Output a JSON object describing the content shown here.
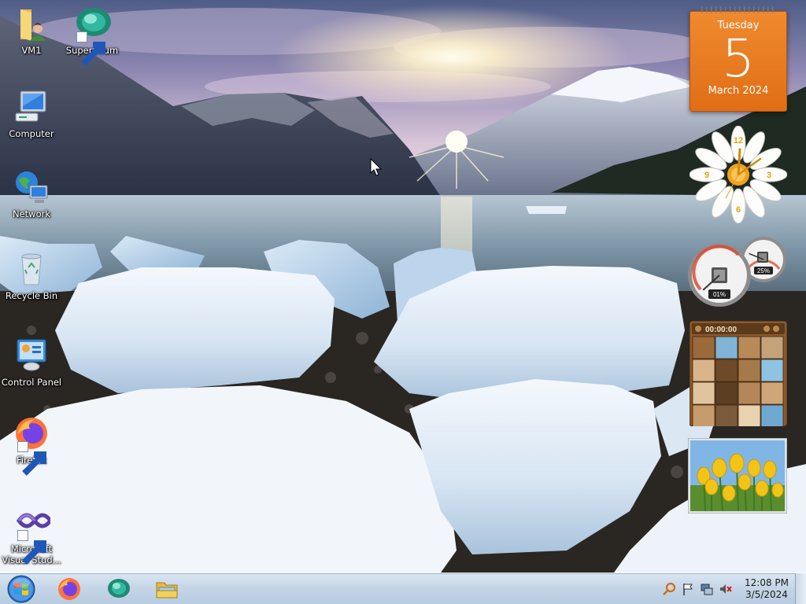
{
  "desktop": {
    "icons": [
      {
        "label": "VM1",
        "icon": "user-folder-icon"
      },
      {
        "label": "Supermium",
        "icon": "supermium-icon"
      },
      {
        "label": "Computer",
        "icon": "computer-icon"
      },
      {
        "label": "Network",
        "icon": "network-icon"
      },
      {
        "label": "Recycle Bin",
        "icon": "recycle-bin-icon"
      },
      {
        "label": "Control Panel",
        "icon": "control-panel-icon"
      },
      {
        "label": "Firefox",
        "icon": "firefox-icon"
      },
      {
        "label": "Microsoft\nVisual Stud...",
        "icon": "visual-studio-icon"
      }
    ]
  },
  "gadgets": {
    "calendar": {
      "day": "Tuesday",
      "date": "5",
      "month": "March 2024"
    },
    "cpu_meter": {
      "cpu": "01%",
      "memory": "25%",
      "cpu_level": 0.01,
      "memory_level": 0.25
    },
    "puzzle": {
      "timer": "00:00:00"
    },
    "clock": {
      "hours": [
        12,
        3,
        6,
        9
      ]
    }
  },
  "taskbar": {
    "pinned": [
      {
        "name": "firefox-taskbar-button",
        "icon": "firefox-icon"
      },
      {
        "name": "supermium-taskbar-button",
        "icon": "supermium-icon"
      },
      {
        "name": "explorer-taskbar-button",
        "icon": "folder-icon"
      }
    ],
    "tray": {
      "time": "12:08 PM",
      "date": "3/5/2024"
    }
  },
  "colors": {
    "taskbar": "#c6d6e8",
    "calendar": "#e9791f",
    "desktop_text": "#ffffff"
  }
}
